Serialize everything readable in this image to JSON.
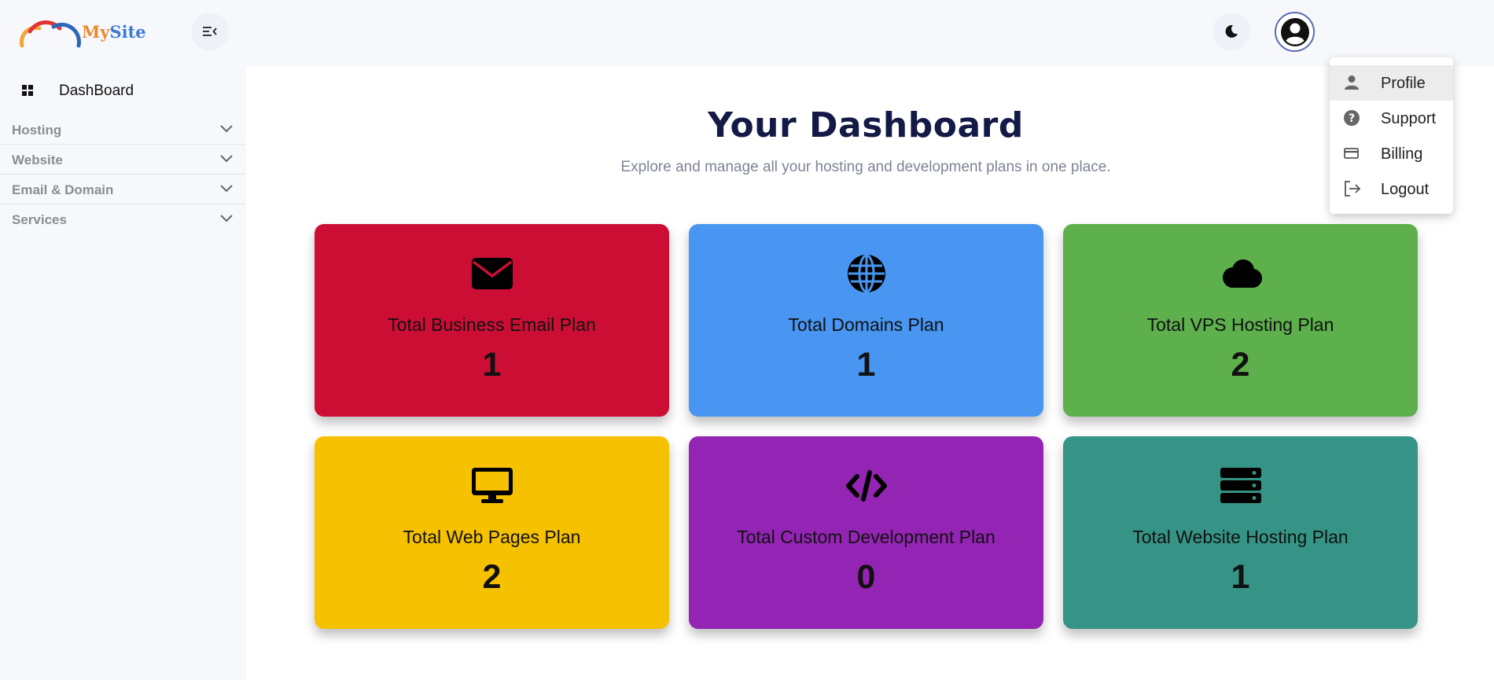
{
  "header": {
    "logo_text_1": "My",
    "logo_text_2": "Site"
  },
  "sidebar": {
    "dashboard_label": "DashBoard",
    "groups": [
      {
        "label": "Hosting"
      },
      {
        "label": "Website"
      },
      {
        "label": "Email & Domain"
      },
      {
        "label": "Services"
      }
    ]
  },
  "main": {
    "title": "Your Dashboard",
    "subtitle": "Explore and manage all your hosting and development plans in one place.",
    "cards": [
      {
        "label": "Total Business Email Plan",
        "value": "1",
        "icon": "envelope-icon",
        "color": "#cc0e35"
      },
      {
        "label": "Total Domains Plan",
        "value": "1",
        "icon": "globe-icon",
        "color": "#4896f1"
      },
      {
        "label": "Total VPS Hosting Plan",
        "value": "2",
        "icon": "cloud-icon",
        "color": "#5db04c"
      },
      {
        "label": "Total Web Pages Plan",
        "value": "2",
        "icon": "desktop-icon",
        "color": "#f6c100"
      },
      {
        "label": "Total Custom Development Plan",
        "value": "0",
        "icon": "code-icon",
        "color": "#9424b3"
      },
      {
        "label": "Total Website Hosting Plan",
        "value": "1",
        "icon": "server-icon",
        "color": "#359485"
      }
    ]
  },
  "dropdown": {
    "items": [
      {
        "label": "Profile",
        "icon": "person-icon"
      },
      {
        "label": "Support",
        "icon": "help-icon"
      },
      {
        "label": "Billing",
        "icon": "credit-card-icon"
      },
      {
        "label": "Logout",
        "icon": "logout-icon"
      }
    ]
  }
}
